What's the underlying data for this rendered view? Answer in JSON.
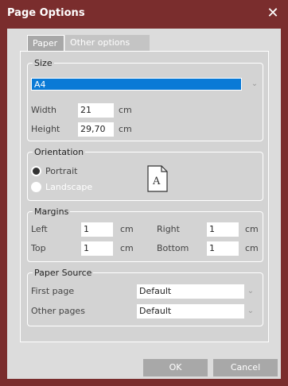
{
  "window": {
    "title": "Page Options",
    "close_glyph": "✕"
  },
  "tabs": [
    {
      "label": "Paper",
      "active": true
    },
    {
      "label": "Other options",
      "active": false
    }
  ],
  "size": {
    "legend": "Size",
    "paper": "A4",
    "width_label": "Width",
    "width_value": "21",
    "width_unit": "cm",
    "height_label": "Height",
    "height_value": "29,70",
    "height_unit": "cm"
  },
  "orientation": {
    "legend": "Orientation",
    "portrait": "Portrait",
    "landscape": "Landscape",
    "selected": "Portrait",
    "preview_letter": "A"
  },
  "margins": {
    "legend": "Margins",
    "left_label": "Left",
    "left_value": "1",
    "right_label": "Right",
    "right_value": "1",
    "top_label": "Top",
    "top_value": "1",
    "bottom_label": "Bottom",
    "bottom_value": "1",
    "unit": "cm"
  },
  "paper_source": {
    "legend": "Paper Source",
    "first_label": "First page",
    "first_value": "Default",
    "other_label": "Other pages",
    "other_value": "Default"
  },
  "buttons": {
    "ok": "OK",
    "cancel": "Cancel"
  },
  "colors": {
    "title_bar": "#7a2d2d",
    "selection": "#0a7ad6",
    "button": "#a8a8a8"
  },
  "icons": {
    "close": "close-icon",
    "chevron": "chevron-down-icon",
    "document": "document-icon"
  }
}
